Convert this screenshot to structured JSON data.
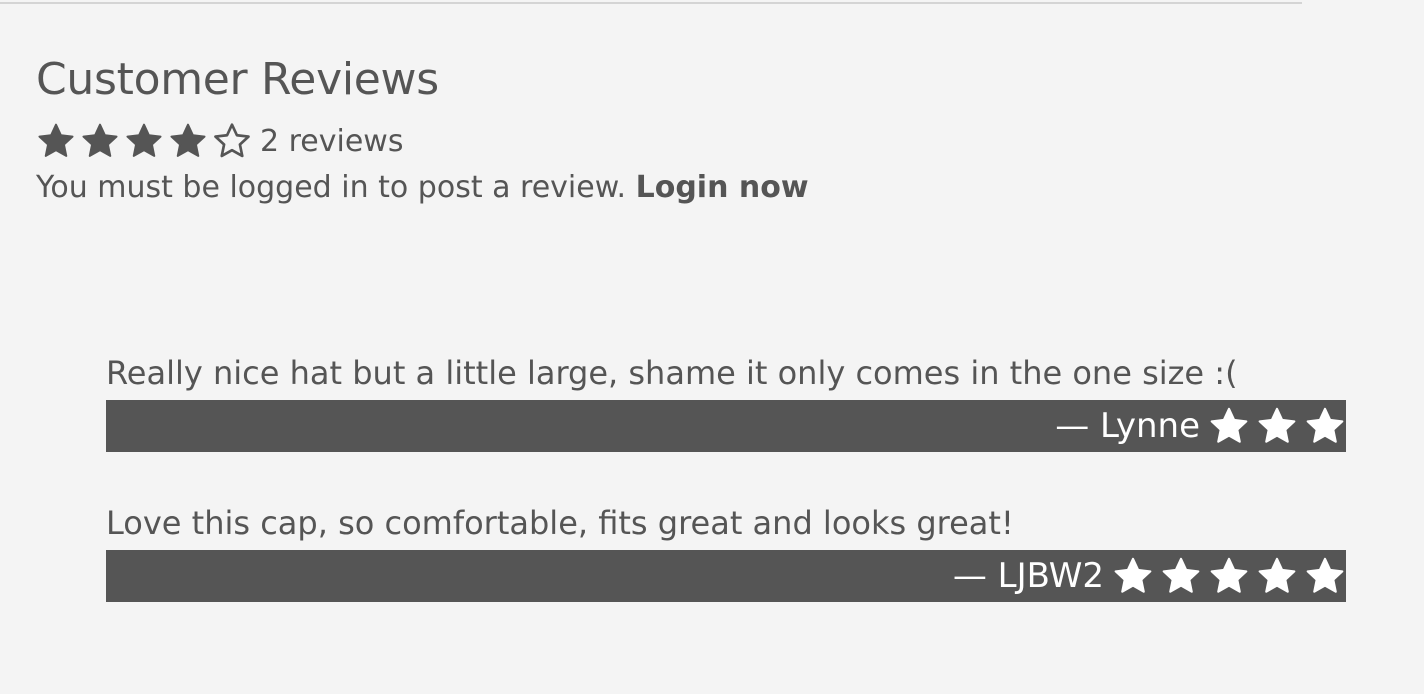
{
  "reviews_section": {
    "title": "Customer Reviews",
    "average_rating": 4,
    "max_rating": 5,
    "review_count_label": "2 reviews",
    "login_prompt": "You must be logged in to post a review.",
    "login_link_label": "Login now"
  },
  "reviews": [
    {
      "text": "Really nice hat but a little large, shame it only comes in the one size :(",
      "author_label": "— Lynne",
      "visible_stars": 3
    },
    {
      "text": "Love this cap, so comfortable, fits great and looks great!",
      "author_label": "— LJBW2",
      "visible_stars": 5
    }
  ],
  "colors": {
    "background": "#f4f4f4",
    "text": "#555555",
    "bar": "#555555",
    "bar_text": "#ffffff"
  },
  "icons": {
    "filled_star": "star-icon",
    "empty_star": "star-outline-icon"
  }
}
